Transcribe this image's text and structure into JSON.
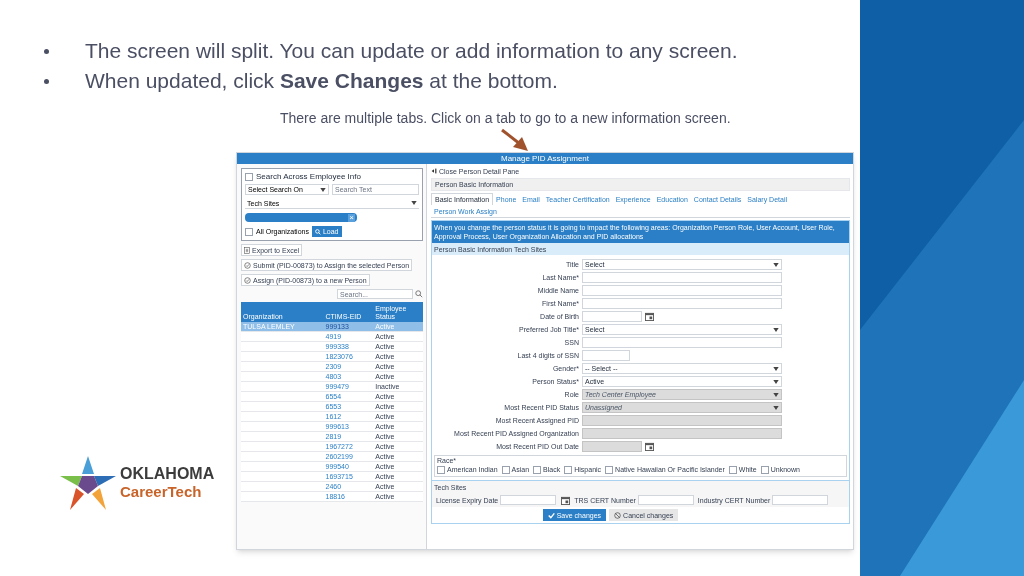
{
  "slide": {
    "bullets": [
      {
        "text": "The screen will split. You can update or add information to any screen."
      },
      {
        "text": "When updated, click **Save Changes** at the bottom."
      }
    ],
    "caption": "There are multiple tabs.  Click on a tab to go to a new information screen.",
    "logo": {
      "line1": "OKLAHOMA",
      "line2": "CareerTech"
    }
  },
  "app": {
    "title": "Manage PID Assignment",
    "left": {
      "search_legend": "Search Across Employee Info",
      "search_checked": false,
      "search_on": "Select Search On",
      "search_placeholder": "Search Text",
      "site": "Tech Sites",
      "tag_remove": "×",
      "all_orgs": {
        "label": "All Organizations",
        "checked": false
      },
      "load": "Load",
      "actions": [
        {
          "label": "Export to Excel",
          "kind": "export"
        },
        {
          "label": "Submit (PID-00873) to Assign the selected Person",
          "kind": "submit"
        },
        {
          "label": "Assign (PID-00873) to a new Person",
          "kind": "submit"
        }
      ],
      "grid_search_placeholder": "Search...",
      "columns": [
        "Organization",
        "CTIMS-EID",
        "Employee Status"
      ],
      "rows": [
        {
          "org": "TULSA LEMLEY",
          "eid": "999133",
          "status": "Active",
          "selected": true
        },
        {
          "org": "",
          "eid": "4919",
          "status": "Active",
          "selected": false
        },
        {
          "org": "",
          "eid": "999338",
          "status": "Active",
          "selected": false
        },
        {
          "org": "",
          "eid": "1823076",
          "status": "Active",
          "selected": false
        },
        {
          "org": "",
          "eid": "2309",
          "status": "Active",
          "selected": false
        },
        {
          "org": "",
          "eid": "4803",
          "status": "Active",
          "selected": false
        },
        {
          "org": "",
          "eid": "999479",
          "status": "Inactive",
          "selected": false
        },
        {
          "org": "",
          "eid": "6554",
          "status": "Active",
          "selected": false
        },
        {
          "org": "",
          "eid": "6553",
          "status": "Active",
          "selected": false
        },
        {
          "org": "",
          "eid": "1612",
          "status": "Active",
          "selected": false
        },
        {
          "org": "",
          "eid": "999613",
          "status": "Active",
          "selected": false
        },
        {
          "org": "",
          "eid": "2819",
          "status": "Active",
          "selected": false
        },
        {
          "org": "",
          "eid": "1967272",
          "status": "Active",
          "selected": false
        },
        {
          "org": "",
          "eid": "2602199",
          "status": "Active",
          "selected": false
        },
        {
          "org": "",
          "eid": "999540",
          "status": "Active",
          "selected": false
        },
        {
          "org": "",
          "eid": "1693715",
          "status": "Active",
          "selected": false
        },
        {
          "org": "",
          "eid": "2460",
          "status": "Active",
          "selected": false
        },
        {
          "org": "",
          "eid": "18816",
          "status": "Active",
          "selected": false
        }
      ]
    },
    "right": {
      "close": "Close Person Detail Pane",
      "section": "Person Basic Information",
      "tabs": [
        {
          "label": "Basic Information",
          "selected": true
        },
        {
          "label": "Phone",
          "selected": false
        },
        {
          "label": "Email",
          "selected": false
        },
        {
          "label": "Teacher Certification",
          "selected": false
        },
        {
          "label": "Experience",
          "selected": false
        },
        {
          "label": "Education",
          "selected": false
        },
        {
          "label": "Contact Details",
          "selected": false
        },
        {
          "label": "Salary Detail",
          "selected": false
        },
        {
          "label": "Person Work Assign",
          "selected": false
        }
      ],
      "notice": "When you change the person status it is going to impact the following areas: Organization Person Role, User Account, User Role, Approval Process, User Organization Allocation and PID allocations",
      "subheader": "Person Basic Information Tech Sites",
      "fields": [
        {
          "label": "Title",
          "kind": "select",
          "value": "Select",
          "disabled": false
        },
        {
          "label": "Last Name*",
          "kind": "text",
          "disabled": false
        },
        {
          "label": "Middle Name",
          "kind": "text",
          "disabled": false
        },
        {
          "label": "First Name*",
          "kind": "text",
          "disabled": false
        },
        {
          "label": "Date of Birth",
          "kind": "date",
          "disabled": false
        },
        {
          "label": "Preferred Job Title*",
          "kind": "select",
          "value": "Select",
          "disabled": false
        },
        {
          "label": "SSN",
          "kind": "text",
          "disabled": false
        },
        {
          "label": "Last 4 digits of SSN",
          "kind": "short",
          "disabled": false
        },
        {
          "label": "Gender*",
          "kind": "select",
          "value": "-- Select --",
          "disabled": false
        },
        {
          "label": "Person Status*",
          "kind": "select",
          "value": "Active",
          "disabled": false
        },
        {
          "label": "Role",
          "kind": "select",
          "value": "Tech Center Employee",
          "disabled": true
        },
        {
          "label": "Most Recent PID Status",
          "kind": "select",
          "value": "Unassigned",
          "disabled": true
        },
        {
          "label": "Most Recent Assigned PID",
          "kind": "text",
          "disabled": true
        },
        {
          "label": "Most Recent PID Assigned Organization",
          "kind": "text",
          "disabled": true
        },
        {
          "label": "Most Recent PID Out Date",
          "kind": "date",
          "disabled": true
        }
      ],
      "race": {
        "legend": "Race*",
        "options": [
          {
            "label": "American Indian",
            "checked": false
          },
          {
            "label": "Asian",
            "checked": false
          },
          {
            "label": "Black",
            "checked": false
          },
          {
            "label": "Hispanic",
            "checked": false
          },
          {
            "label": "Native Hawaiian Or Pacific Islander",
            "checked": false
          },
          {
            "label": "White",
            "checked": false
          },
          {
            "label": "Unknown",
            "checked": false
          }
        ]
      },
      "tech_sites": {
        "title": "Tech Sites",
        "fields": [
          {
            "label": "License Expiry Date",
            "kind": "date"
          },
          {
            "label": "TRS CERT Number",
            "kind": "text"
          },
          {
            "label": "Industry CERT Number",
            "kind": "text"
          }
        ]
      },
      "save": "Save changes",
      "cancel": "Cancel changes"
    }
  }
}
